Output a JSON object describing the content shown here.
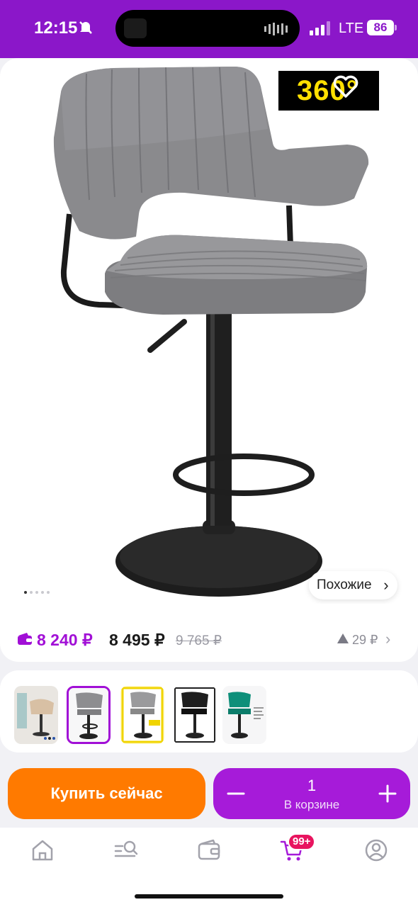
{
  "status_bar": {
    "time": "12:15",
    "network": "LTE",
    "battery": "86",
    "background_color": "#8b17c9"
  },
  "product_gallery": {
    "badge_360": "360°",
    "icons": [
      "back-chevron-icon",
      "heart-icon",
      "share-icon"
    ],
    "page_count": 5,
    "active_page": 1,
    "similar_label": "Похожие",
    "similar_icon": "chevron-right-icon"
  },
  "prices": {
    "wallet_price": "8 240 ₽",
    "regular_price": "8 495 ₽",
    "old_price": "9 765 ₽",
    "price_change": "29 ₽",
    "wallet_color": "#a10fd6"
  },
  "variants": [
    {
      "name": "beige",
      "selected": false
    },
    {
      "name": "gray",
      "selected": true
    },
    {
      "name": "gray-yellow-frame",
      "selected": false
    },
    {
      "name": "black",
      "selected": false
    },
    {
      "name": "teal",
      "selected": false
    }
  ],
  "purchase": {
    "buy_now_label": "Купить сейчас",
    "quantity": "1",
    "in_cart_label": "В корзине",
    "buy_color": "#ff7a00",
    "cart_color": "#a61bd9"
  },
  "bottom_nav": {
    "items": [
      "home-icon",
      "catalog-search-icon",
      "wallet-icon",
      "cart-icon",
      "profile-icon"
    ],
    "cart_badge": "99+"
  }
}
